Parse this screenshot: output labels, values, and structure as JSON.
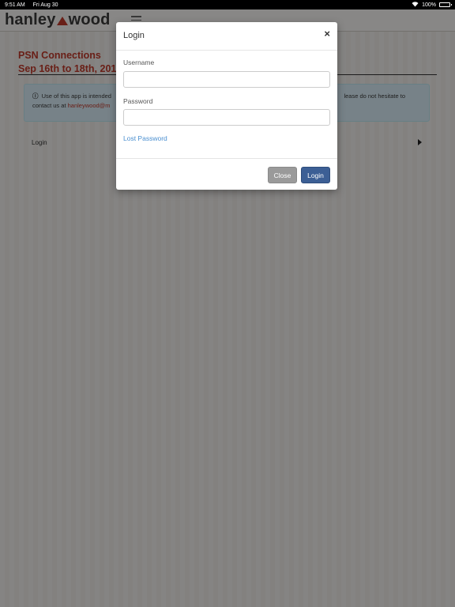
{
  "status_bar": {
    "time": "9:51 AM",
    "date": "Fri Aug 30",
    "battery": "100%"
  },
  "header": {
    "logo_left": "hanley",
    "logo_right": "wood"
  },
  "event": {
    "name": "PSN Connections",
    "dates": "Sep 16th to 18th, 2019"
  },
  "notice": {
    "line1": "Use of this app is intended",
    "line1_right": "lease do not hesitate to",
    "line2_prefix": "contact us at",
    "email": "hanleywood@m"
  },
  "menu": {
    "login_label": "Login"
  },
  "modal": {
    "title": "Login",
    "close_symbol": "×",
    "username_label": "Username",
    "username_value": "",
    "password_label": "Password",
    "password_value": "",
    "lost_password": "Lost Password",
    "close_button": "Close",
    "login_button": "Login"
  }
}
